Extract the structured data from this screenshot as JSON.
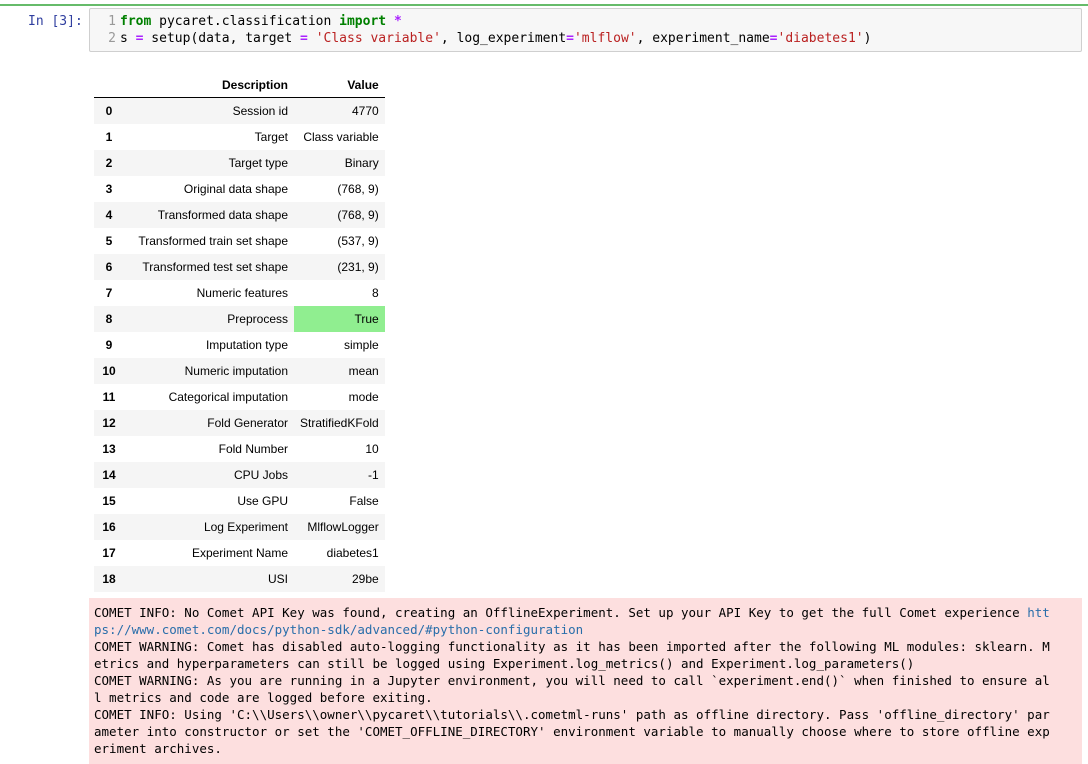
{
  "cell": {
    "prompt": "In [3]:",
    "code_lines": [
      {
        "num": "1",
        "parts": [
          [
            "kw",
            "from"
          ],
          [
            "t",
            " pycaret.classification "
          ],
          [
            "kw",
            "import"
          ],
          [
            "t",
            " "
          ],
          [
            "op",
            "*"
          ]
        ]
      },
      {
        "num": "2",
        "parts": [
          [
            "t",
            "s "
          ],
          [
            "op",
            "="
          ],
          [
            "t",
            " setup(data, target "
          ],
          [
            "op",
            "="
          ],
          [
            "t",
            " "
          ],
          [
            "str",
            "'Class variable'"
          ],
          [
            "t",
            ", log_experiment"
          ],
          [
            "op",
            "="
          ],
          [
            "str",
            "'mlflow'"
          ],
          [
            "t",
            ", experiment_name"
          ],
          [
            "op",
            "="
          ],
          [
            "str",
            "'diabetes1'"
          ],
          [
            "t",
            ")"
          ]
        ]
      }
    ]
  },
  "setup_table": {
    "headers": [
      "",
      "Description",
      "Value"
    ],
    "highlight_color": "#90ee90",
    "rows": [
      {
        "index": "0",
        "description": "Session id",
        "value": "4770"
      },
      {
        "index": "1",
        "description": "Target",
        "value": "Class variable"
      },
      {
        "index": "2",
        "description": "Target type",
        "value": "Binary"
      },
      {
        "index": "3",
        "description": "Original data shape",
        "value": "(768, 9)"
      },
      {
        "index": "4",
        "description": "Transformed data shape",
        "value": "(768, 9)"
      },
      {
        "index": "5",
        "description": "Transformed train set shape",
        "value": "(537, 9)"
      },
      {
        "index": "6",
        "description": "Transformed test set shape",
        "value": "(231, 9)"
      },
      {
        "index": "7",
        "description": "Numeric features",
        "value": "8"
      },
      {
        "index": "8",
        "description": "Preprocess",
        "value": "True",
        "highlight": true
      },
      {
        "index": "9",
        "description": "Imputation type",
        "value": "simple"
      },
      {
        "index": "10",
        "description": "Numeric imputation",
        "value": "mean"
      },
      {
        "index": "11",
        "description": "Categorical imputation",
        "value": "mode"
      },
      {
        "index": "12",
        "description": "Fold Generator",
        "value": "StratifiedKFold"
      },
      {
        "index": "13",
        "description": "Fold Number",
        "value": "10"
      },
      {
        "index": "14",
        "description": "CPU Jobs",
        "value": "-1"
      },
      {
        "index": "15",
        "description": "Use GPU",
        "value": "False"
      },
      {
        "index": "16",
        "description": "Log Experiment",
        "value": "MlflowLogger"
      },
      {
        "index": "17",
        "description": "Experiment Name",
        "value": "diabetes1"
      },
      {
        "index": "18",
        "description": "USI",
        "value": "29be"
      }
    ]
  },
  "stderr": {
    "background": "#fddfdf",
    "lines": [
      [
        [
          "t",
          "COMET INFO: No Comet API Key was found, creating an OfflineExperiment. Set up your API Key to get the full Comet experience "
        ],
        [
          "link",
          "htt"
        ]
      ],
      [
        [
          "link",
          "ps://www.comet.com/docs/python-sdk/advanced/#python-configuration"
        ]
      ],
      [
        [
          "t",
          "COMET WARNING: Comet has disabled auto-logging functionality as it has been imported after the following ML modules: sklearn. M"
        ]
      ],
      [
        [
          "t",
          "etrics and hyperparameters can still be logged using Experiment.log_metrics() and Experiment.log_parameters()"
        ]
      ],
      [
        [
          "t",
          "COMET WARNING: As you are running in a Jupyter environment, you will need to call `experiment.end()` when finished to ensure al"
        ]
      ],
      [
        [
          "t",
          "l metrics and code are logged before exiting."
        ]
      ],
      [
        [
          "t",
          "COMET INFO: Using 'C:\\\\Users\\\\owner\\\\pycaret\\\\tutorials\\\\.cometml-runs' path as offline directory. Pass 'offline_directory' par"
        ]
      ],
      [
        [
          "t",
          "ameter into constructor or set the 'COMET_OFFLINE_DIRECTORY' environment variable to manually choose where to store offline exp"
        ]
      ],
      [
        [
          "t",
          "eriment archives."
        ]
      ]
    ]
  }
}
